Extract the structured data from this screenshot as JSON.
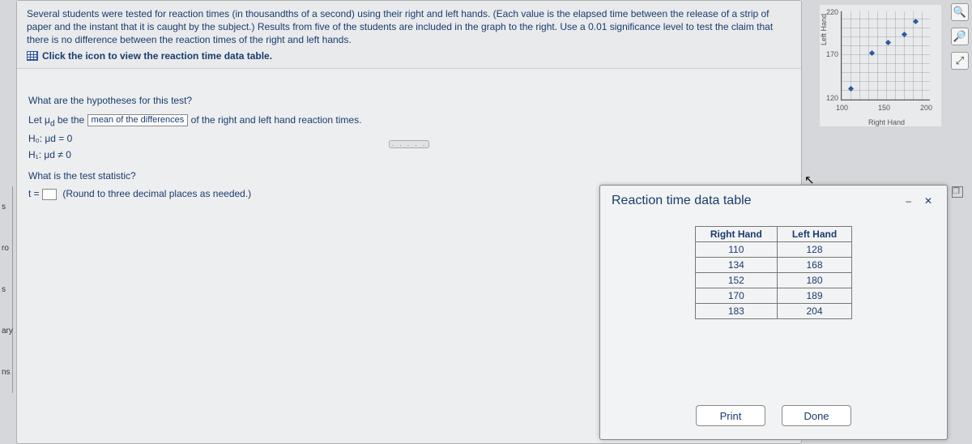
{
  "sidebar": {
    "tab1": "s",
    "tab2": "ro",
    "tab3": "s",
    "tab4": "ary",
    "tab5": "ns"
  },
  "prompt": {
    "text": "Several students were tested for reaction times (in thousandths of a second) using their right and left hands. (Each value is the elapsed time between the release of a strip of paper and the instant that it is caught by the subject.) Results from five of the students are included in the graph to the right. Use a 0.01 significance level to test the claim that there is no difference between the reaction times of the right and left hands.",
    "link": "Click the icon to view the reaction time data table."
  },
  "question": {
    "hypo_q": "What are the hypotheses for this test?",
    "let_pre": "Let μ",
    "let_sub": "d",
    "let_post": " be the ",
    "blank1": "mean of the differences",
    "let_tail": " of the right and left hand reaction times.",
    "h0": "H₀: μd   =  0",
    "h1": "H₁: μd   ≠  0",
    "stat_q": "What is the test statistic?",
    "t_eq": "t = ",
    "round": "(Round to three decimal places as needed.)"
  },
  "chart_data": {
    "type": "scatter",
    "xlabel": "Right Hand",
    "ylabel": "Left Hand",
    "xticks": [
      100,
      150,
      200
    ],
    "yticks": [
      120,
      170,
      220
    ],
    "xlim": [
      100,
      200
    ],
    "ylim": [
      120,
      220
    ],
    "x": [
      110,
      134,
      152,
      170,
      183
    ],
    "y": [
      128,
      168,
      180,
      189,
      204
    ]
  },
  "toolbar": {
    "zoom_in": "zoom-in",
    "zoom_out": "zoom-out",
    "open": "open-external"
  },
  "dialog": {
    "title": "Reaction time data table",
    "minimize": "–",
    "close": "✕",
    "headers": [
      "Right Hand",
      "Left Hand"
    ],
    "rows": [
      [
        "110",
        "128"
      ],
      [
        "134",
        "168"
      ],
      [
        "152",
        "180"
      ],
      [
        "170",
        "189"
      ],
      [
        "183",
        "204"
      ]
    ],
    "print": "Print",
    "done": "Done"
  },
  "divider": "· · · · ·"
}
